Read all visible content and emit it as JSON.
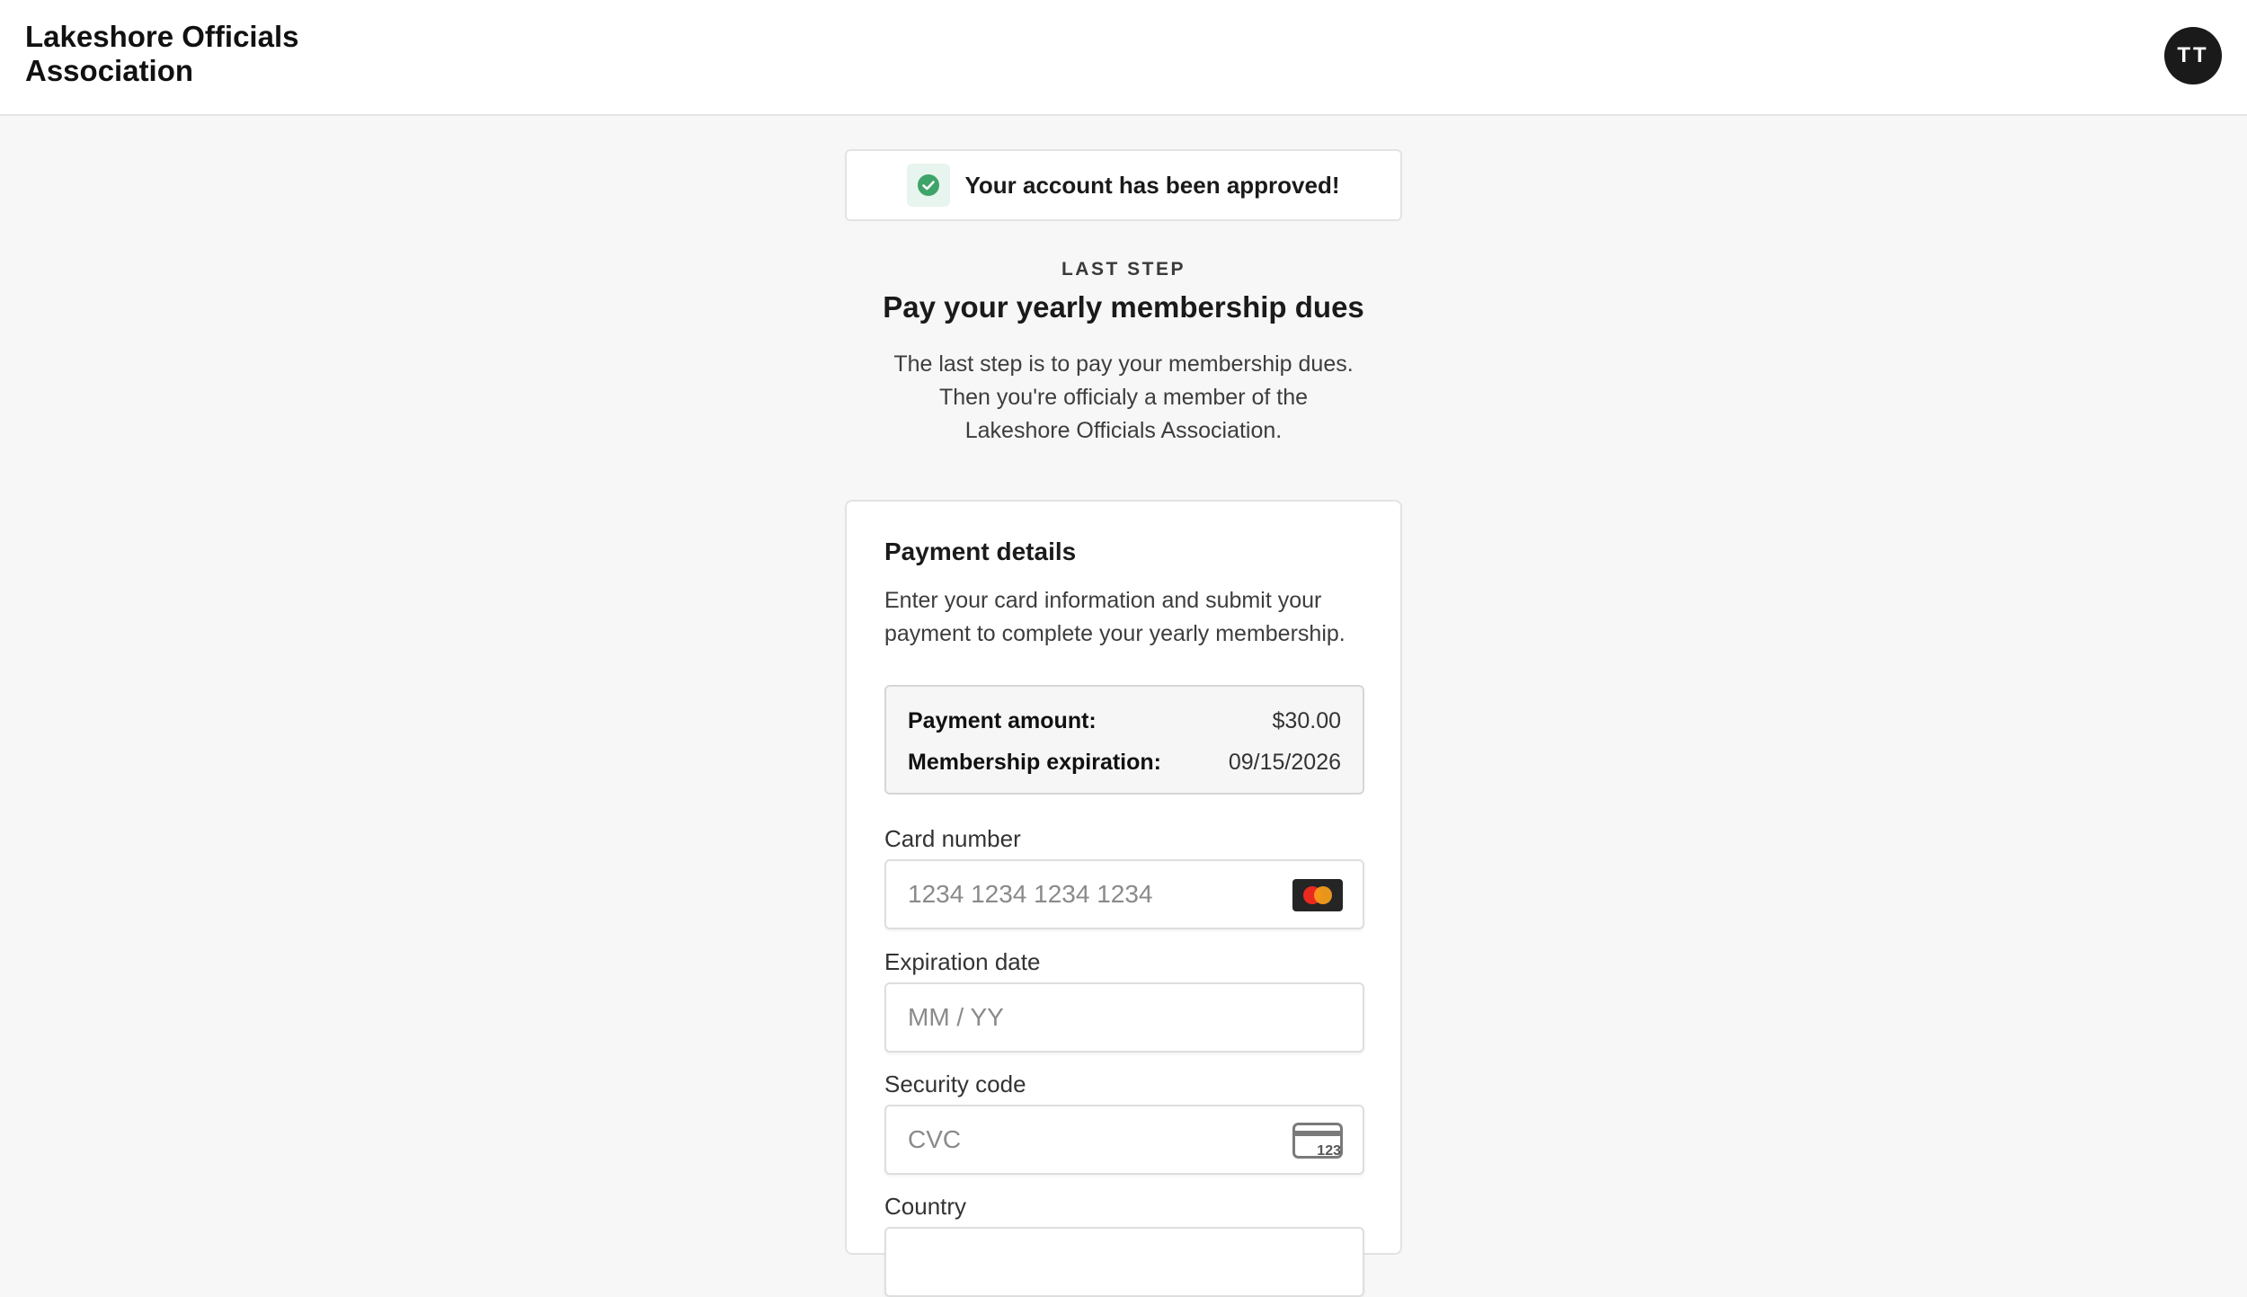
{
  "header": {
    "brand": "Lakeshore Officials Association",
    "avatar_initials": "TT"
  },
  "alert": {
    "icon": "check-circle-icon",
    "message": "Your account has been approved!",
    "color": "#3fa46a"
  },
  "intro": {
    "eyebrow": "LAST STEP",
    "title": "Pay your yearly membership dues",
    "body": "The last step is to pay your membership dues. Then you're officialy a member of the Lakeshore Officials Association."
  },
  "payment": {
    "title": "Payment details",
    "description": "Enter your card information and submit your payment to complete your yearly membership.",
    "summary": {
      "amount_label": "Payment amount:",
      "amount_value": "$30.00",
      "expiration_label": "Membership expiration:",
      "expiration_value": "09/15/2026"
    },
    "fields": {
      "card_number": {
        "label": "Card number",
        "placeholder": "1234 1234 1234 1234",
        "value": "",
        "icon": "mastercard-icon"
      },
      "expiration": {
        "label": "Expiration date",
        "placeholder": "MM / YY",
        "value": ""
      },
      "security": {
        "label": "Security code",
        "placeholder": "CVC",
        "value": "",
        "icon": "cvc-card-icon",
        "icon_text": "123"
      },
      "country": {
        "label": "Country"
      }
    }
  }
}
